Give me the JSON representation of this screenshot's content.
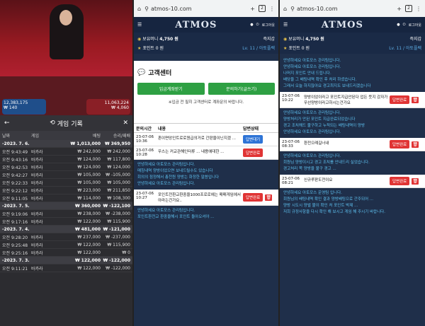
{
  "p1": {
    "title": "게임 기록",
    "cols": [
      "날짜",
      "게임",
      "배팅",
      "승리/패배"
    ],
    "bets": [
      {
        "v": "12,383,175",
        "s": "₩ 140"
      },
      {
        "v": "11,063,224",
        "s": "₩ 4,060"
      }
    ],
    "rows": [
      {
        "d": "-2023. 7. 6.",
        "g": "",
        "b": "₩ 1,013,000",
        "r": "₩ 369,950",
        "date": true
      },
      {
        "d": "오전 9:43:49",
        "g": "바카라",
        "b": "₩ 242,000",
        "r": "₩ 242,000"
      },
      {
        "d": "오전 9:43:16",
        "g": "바카라",
        "b": "₩ 124,000",
        "r": "₩ 117,800"
      },
      {
        "d": "오전 9:42:53",
        "g": "바카라",
        "b": "₩ 124,000",
        "r": "₩ 124,000"
      },
      {
        "d": "오전 9:42:27",
        "g": "바카라",
        "b": "₩ 105,000",
        "r": "₩ -105,000"
      },
      {
        "d": "오전 9:22:33",
        "g": "바카라",
        "b": "₩ 105,000",
        "r": "₩ 105,000"
      },
      {
        "d": "오전 9:22:12",
        "g": "바카라",
        "b": "₩ 223,000",
        "r": "₩ 211,850"
      },
      {
        "d": "오전 9:11:05",
        "g": "바카라",
        "b": "₩ 114,000",
        "r": "₩ 108,300"
      },
      {
        "d": "-2023. 7. 5.",
        "g": "",
        "b": "₩ 360,000",
        "r": "₩ -122,100",
        "date": true
      },
      {
        "d": "오전 9:19:06",
        "g": "바카라",
        "b": "₩ 238,000",
        "r": "₩ -238,000"
      },
      {
        "d": "오전 9:17:16",
        "g": "바카라",
        "b": "₩ 122,000",
        "r": "₩ 115,900"
      },
      {
        "d": "-2023. 7. 4.",
        "g": "",
        "b": "₩ 481,000",
        "r": "₩ -121,000",
        "date": true
      },
      {
        "d": "오전 9:28:20",
        "g": "바카라",
        "b": "₩ 237,000",
        "r": "₩ -237,000"
      },
      {
        "d": "오전 9:25:48",
        "g": "바카라",
        "b": "₩ 122,000",
        "r": "₩ 115,900"
      },
      {
        "d": "오전 9:25:16",
        "g": "바카라",
        "b": "₩ 122,000",
        "r": "₩ 0"
      },
      {
        "d": "-2023. 7. 3.",
        "g": "",
        "b": "₩ 122,000",
        "r": "₩ -122,000",
        "date": true
      },
      {
        "d": "오전 9:11:21",
        "g": "바카라",
        "b": "₩ 122,000",
        "r": "₩ -122,000"
      }
    ]
  },
  "browser": {
    "url": "atmos-10.com",
    "tabs": "2"
  },
  "app": {
    "logo": "ATMOS",
    "logout": "로그아웃",
    "money_label": "보유머니",
    "money": "4,750 원",
    "charge": "즉지갑",
    "point_label": "포인트",
    "point": "0 원",
    "level": "Lv. 11 / 아토플렉"
  },
  "cs": {
    "title": "고객센터",
    "b1": "입금계좌받기",
    "b2": "문의하기(글쓰기)",
    "note": "※입금 전 필히 고객센터로 계좌문의 바랍니다.",
    "h1": "문의시간",
    "h2": "내용",
    "h3": "답변상태",
    "e1": {
      "t": "23-07-06 10:36",
      "c": "혼이면앙인트로로원급의거로 간판을이닌지겠 ...",
      "s": "답변대기"
    },
    "e2": {
      "t": "23-07-06 10:28",
      "c": "우스는 커교관해인터류 ... 내용에대한 ...",
      "s": "답변완료"
    },
    "r1": "안녕하세요 아토모스 관리팀입니다.",
    "r2": "매칭내역 양방이었으면 보내드릴수도 있습니다",
    "r3": "회의의 점정해서 총천원 양방는 화정한 말씀입니다",
    "r4": "안녕하세요 아토모스 관리팀입니다.",
    "e3": {
      "t": "23-07-06 10:27",
      "c": "포인트전환교환중을1000프로로에는 매매게임에서아라는건가요..",
      "s": "답변완료"
    },
    "r5": "안녕하세요 아토모스 관리팀입니다.",
    "r6": "포인트환전교 환중을해시 포인트 돌아오셔야 ..."
  },
  "p3": {
    "r1": "안녕하세요 아토모스 관리팀입니다.",
    "r2": "안녕하세요 아토모스 관리팀입니다.",
    "r3": "나머지 포인트 안내 드립니다.",
    "r4": "배당을 그 배팅내역 확인 후 처리 하셨습니다.",
    "r5": "그래서 오늘 하지잖아요 경고최지도 보내드리겠습니다",
    "e1": {
      "t": "23-07-06 10:22",
      "c": "양방이었이라고 포인트지급안된다 업든 뜻지 갔자가 우선양방이라고하시는건가요",
      "s": "답변완료"
    },
    "r6": "안녕하세요 아토모스 관리팀입니다.",
    "r7": "양방처리가 안된 포인트 지급완료되었습니다",
    "r8": "경고 조치해드 불구하고 누적되는 배팅내역이 양방",
    "r9": "안녕하세요 아토모스 관리팀입니다.",
    "e2": {
      "t": "23-07-06 08:33",
      "c": "환전으례길너내",
      "s": "답변완료"
    },
    "r10": "안녕하세요 아토모스 관리팀입니다.",
    "r11": "회원님 양방이시고 경고 조치를 안내드리 실었습니다.",
    "r12": "경고처리 쪽 양방을 불구 경고 ...",
    "e3": {
      "t": "23-07-06 08:21",
      "c": "신규루판도전이요",
      "s": "답변완료"
    },
    "r13": "안녕하세요 아토모스 운영팀 입니다.",
    "r14": "회원님의 배팅내역 확인 결과 양방배팅으로 간주되어 ...",
    "r15": "양방 시도시 양벌 불이 확인 처 포인트 박제 ...",
    "r16": "저희 규정사항을 다시 확인 해 보시고 게임 해 주시기 바랍니다."
  }
}
